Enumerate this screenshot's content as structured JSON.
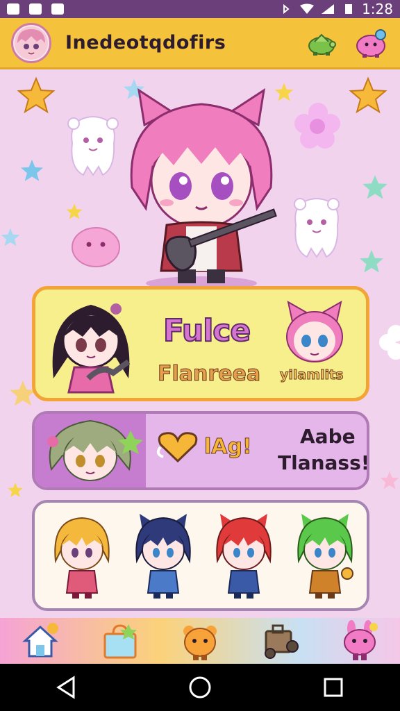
{
  "status_bar": {
    "time": "1:28"
  },
  "header": {
    "title": "Inedeotqdofirs"
  },
  "card_1": {
    "title": "Fulce",
    "subtitle": "Flanreea",
    "side_label": "yilamlits"
  },
  "card_2": {
    "tag": "lAg!",
    "right_line1": "Aabe",
    "right_line2": "Tlanass!"
  },
  "icons": {
    "header": [
      "avatar",
      "turtle-icon",
      "pink-creature-icon"
    ],
    "bottom_nav": [
      "home-icon",
      "shop-bag-icon",
      "bear-icon",
      "toolbox-icon",
      "bunny-icon"
    ],
    "system_nav": [
      "back-icon",
      "home-circle-icon",
      "recents-icon"
    ]
  },
  "colors": {
    "header_bg": "#f5c33b",
    "status_bg": "#6b3f79",
    "page_bg": "#f2d3ee",
    "accent_pink": "#d575cf"
  }
}
